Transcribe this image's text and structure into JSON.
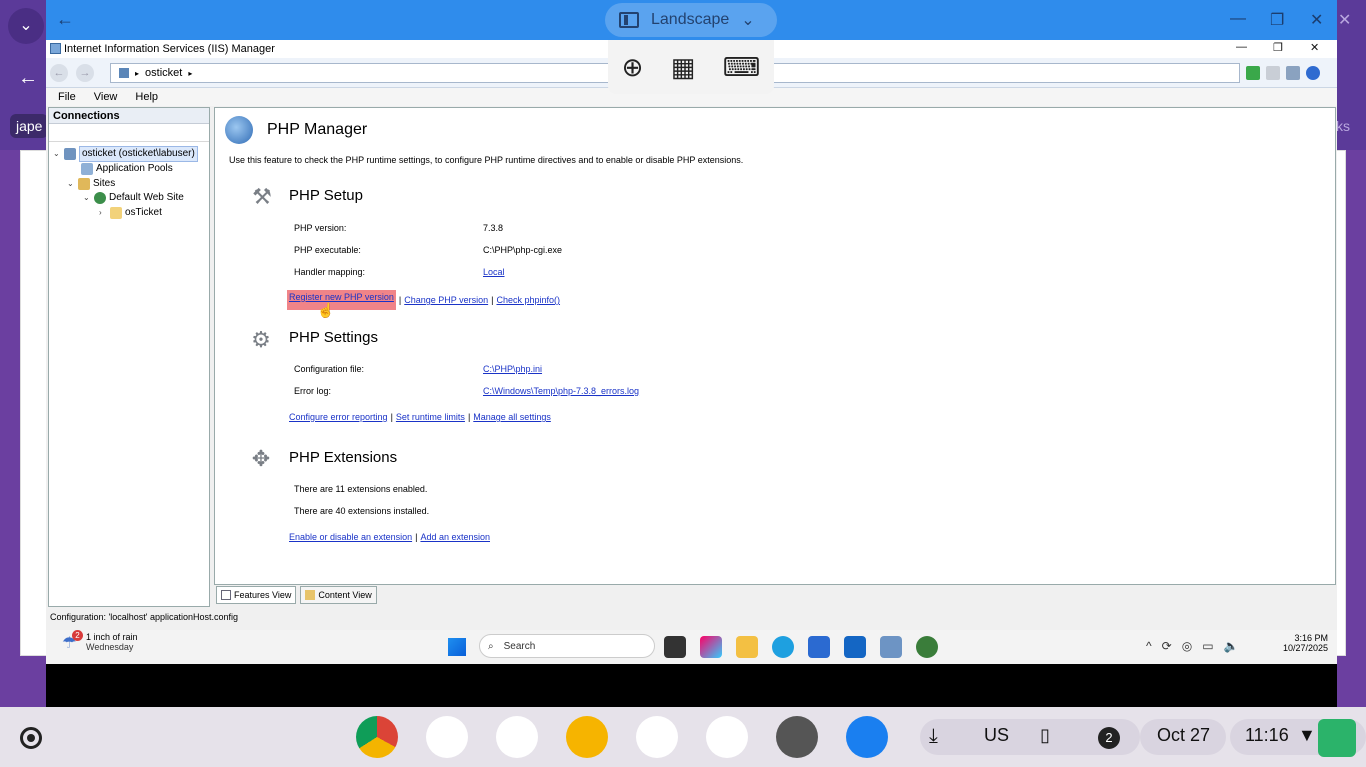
{
  "background": {
    "app_label": "jape",
    "right_text": "ks"
  },
  "rdp": {
    "orientation_label": "Landscape"
  },
  "iis": {
    "window_title": "Internet Information Services (IIS) Manager",
    "address": "osticket",
    "menu": [
      "File",
      "View",
      "Help"
    ],
    "connections_header": "Connections",
    "tree": [
      {
        "label": "osticket (osticket\\labuser)"
      },
      {
        "label": "Application Pools"
      },
      {
        "label": "Sites"
      },
      {
        "label": "Default Web Site"
      },
      {
        "label": "osTicket"
      }
    ],
    "page_title": "PHP Manager",
    "page_desc": "Use this feature to check the PHP runtime settings, to configure PHP runtime directives and to enable or disable PHP extensions.",
    "setup": {
      "title": "PHP Setup",
      "rows": [
        {
          "label": "PHP version:",
          "value": "7.3.8"
        },
        {
          "label": "PHP executable:",
          "value": "C:\\PHP\\php-cgi.exe"
        },
        {
          "label": "Handler mapping:",
          "value": "Local"
        }
      ],
      "links": [
        "Register new PHP version",
        "Change PHP version",
        "Check phpinfo()"
      ],
      "separator": "|"
    },
    "settings": {
      "title": "PHP Settings",
      "rows": [
        {
          "label": "Configuration file:",
          "value": "C:\\PHP\\php.ini"
        },
        {
          "label": "Error log:",
          "value": "C:\\Windows\\Temp\\php-7.3.8_errors.log"
        }
      ],
      "links": [
        "Configure error reporting",
        "Set runtime limits",
        "Manage all settings"
      ]
    },
    "extensions": {
      "title": "PHP Extensions",
      "lines": [
        "There are 11 extensions enabled.",
        "There are 40 extensions installed."
      ],
      "links": [
        "Enable or disable an extension",
        "Add an extension"
      ]
    },
    "tabs": [
      "Features View",
      "Content View"
    ],
    "status": "Configuration: 'localhost' applicationHost.config"
  },
  "taskbar": {
    "weather_badge": "2",
    "weather_line1": "1 inch of rain",
    "weather_line2": "Wednesday",
    "search_placeholder": "Search",
    "time": "3:16 PM",
    "date": "10/27/2025"
  },
  "shelf": {
    "ime": "US",
    "notif_count": "2",
    "date": "Oct 27",
    "time": "11:16"
  }
}
